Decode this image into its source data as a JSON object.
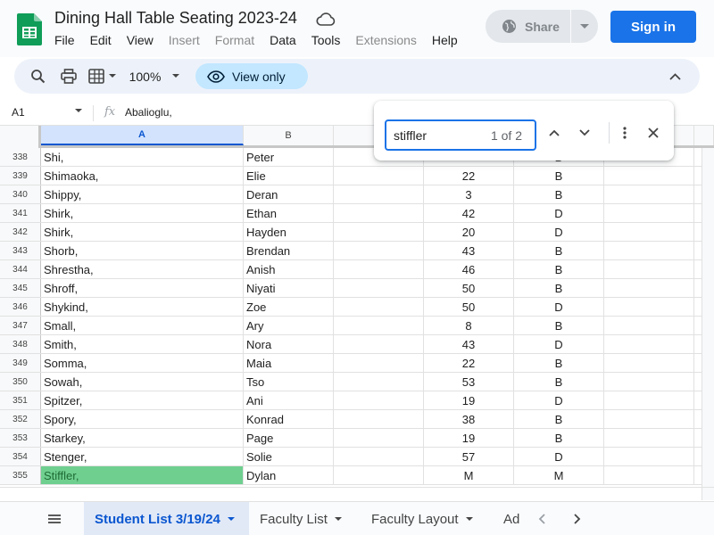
{
  "app": {
    "title": "Dining Hall Table Seating 2023-24",
    "menu": [
      {
        "label": "File",
        "enabled": true
      },
      {
        "label": "Edit",
        "enabled": true
      },
      {
        "label": "View",
        "enabled": true
      },
      {
        "label": "Insert",
        "enabled": false
      },
      {
        "label": "Format",
        "enabled": false
      },
      {
        "label": "Data",
        "enabled": true
      },
      {
        "label": "Tools",
        "enabled": true
      },
      {
        "label": "Extensions",
        "enabled": false
      },
      {
        "label": "Help",
        "enabled": true
      }
    ],
    "share_label": "Share",
    "signin_label": "Sign in"
  },
  "toolbar": {
    "zoom": "100%",
    "view_only_label": "View only"
  },
  "formula_bar": {
    "name_box": "A1",
    "fx": "fx",
    "value": "Abalioglu,"
  },
  "find": {
    "query": "stiffler",
    "count": "1 of 2"
  },
  "grid": {
    "columns": [
      "A",
      "B",
      "",
      "",
      "",
      "",
      ""
    ],
    "selected_column": "A",
    "rows": [
      {
        "n": "338",
        "last": "Shi,",
        "first": "Peter",
        "table": "",
        "section": "B",
        "hit": false
      },
      {
        "n": "339",
        "last": "Shimaoka,",
        "first": "Elie",
        "table": "22",
        "section": "B",
        "hit": false
      },
      {
        "n": "340",
        "last": "Shippy,",
        "first": "Deran",
        "table": "3",
        "section": "B",
        "hit": false
      },
      {
        "n": "341",
        "last": "Shirk,",
        "first": "Ethan",
        "table": "42",
        "section": "D",
        "hit": false
      },
      {
        "n": "342",
        "last": "Shirk,",
        "first": "Hayden",
        "table": "20",
        "section": "D",
        "hit": false
      },
      {
        "n": "343",
        "last": "Shorb,",
        "first": "Brendan",
        "table": "43",
        "section": "B",
        "hit": false
      },
      {
        "n": "344",
        "last": "Shrestha,",
        "first": "Anish",
        "table": "46",
        "section": "B",
        "hit": false
      },
      {
        "n": "345",
        "last": "Shroff,",
        "first": "Niyati",
        "table": "50",
        "section": "B",
        "hit": false
      },
      {
        "n": "346",
        "last": "Shykind,",
        "first": "Zoe",
        "table": "50",
        "section": "D",
        "hit": false
      },
      {
        "n": "347",
        "last": "Small,",
        "first": "Ary",
        "table": "8",
        "section": "B",
        "hit": false
      },
      {
        "n": "348",
        "last": "Smith,",
        "first": "Nora",
        "table": "43",
        "section": "D",
        "hit": false
      },
      {
        "n": "349",
        "last": "Somma,",
        "first": "Maia",
        "table": "22",
        "section": "B",
        "hit": false
      },
      {
        "n": "350",
        "last": "Sowah,",
        "first": "Tso",
        "table": "53",
        "section": "B",
        "hit": false
      },
      {
        "n": "351",
        "last": "Spitzer,",
        "first": "Ani",
        "table": "19",
        "section": "D",
        "hit": false
      },
      {
        "n": "352",
        "last": "Spory,",
        "first": "Konrad",
        "table": "38",
        "section": "B",
        "hit": false
      },
      {
        "n": "353",
        "last": "Starkey,",
        "first": "Page",
        "table": "19",
        "section": "B",
        "hit": false
      },
      {
        "n": "354",
        "last": "Stenger,",
        "first": "Solie",
        "table": "57",
        "section": "D",
        "hit": false
      },
      {
        "n": "355",
        "last": "Stiffler,",
        "first": "Dylan",
        "table": "M",
        "section": "M",
        "hit": true
      }
    ]
  },
  "sheets": {
    "tabs": [
      {
        "label": "Student List 3/19/24",
        "active": true
      },
      {
        "label": "Faculty List",
        "active": false
      },
      {
        "label": "Faculty Layout",
        "active": false
      },
      {
        "label": "Ad",
        "active": false
      }
    ]
  },
  "colors": {
    "accent": "#1a73e8",
    "sheets_green": "#0f9d58",
    "find_highlight": "#6fcf8f",
    "view_only_bg": "#c2e7ff"
  }
}
